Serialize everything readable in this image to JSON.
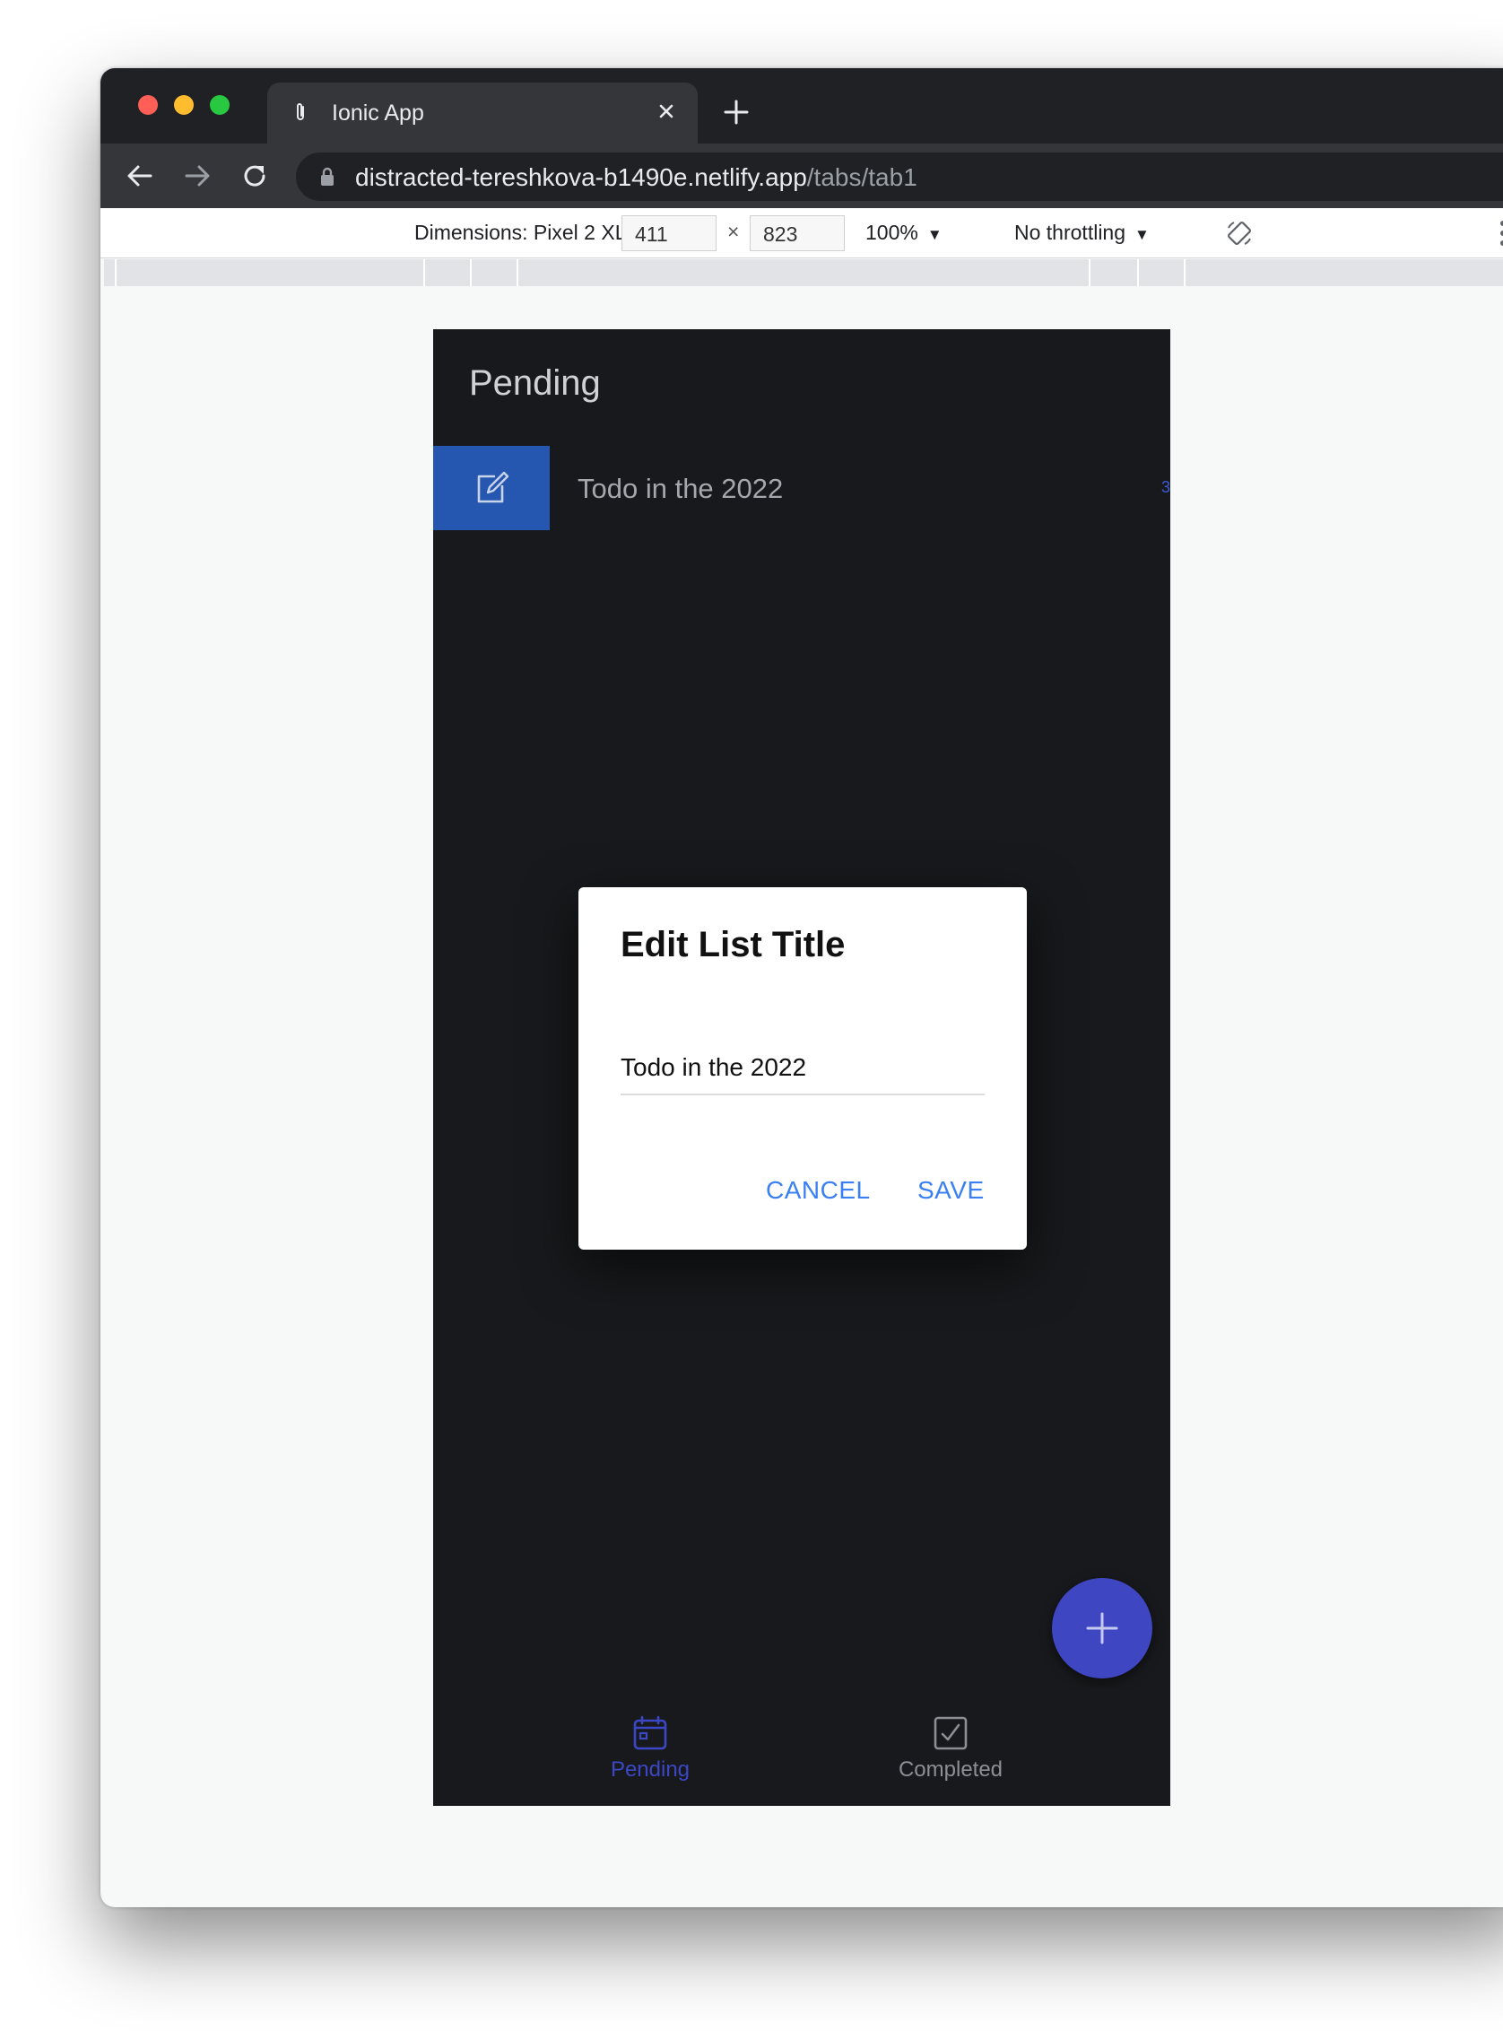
{
  "browser": {
    "tab_title": "Ionic App",
    "url_host": "distracted-tereshkova-b1490e.netlify.app",
    "url_path": "/tabs/tab1"
  },
  "devtools": {
    "dimensions_label": "Dimensions: Pixel 2 XL",
    "width": "411",
    "times": "×",
    "height": "823",
    "zoom": "100%",
    "throttling": "No throttling",
    "dropdown_arrow": "▼"
  },
  "app": {
    "page_title": "Pending",
    "list_items": [
      {
        "label": "Todo in the 2022",
        "count": "3"
      }
    ],
    "tabs": [
      {
        "label": "Pending",
        "selected": true
      },
      {
        "label": "Completed",
        "selected": false
      }
    ]
  },
  "dialog": {
    "title": "Edit List Title",
    "input_value": "Todo in the 2022",
    "cancel_label": "CANCEL",
    "save_label": "SAVE"
  },
  "colors": {
    "accent": "#3a80f2",
    "fab": "#3f46c2",
    "swipe_option": "#2557b0",
    "app_background": "#18191c"
  },
  "icons": [
    "paperclip-icon",
    "close-icon",
    "plus-icon",
    "back-arrow-icon",
    "forward-arrow-icon",
    "reload-icon",
    "lock-icon",
    "rotate-icon",
    "more-vert-icon",
    "edit-icon",
    "add-icon",
    "calendar-icon",
    "checkbox-icon"
  ]
}
